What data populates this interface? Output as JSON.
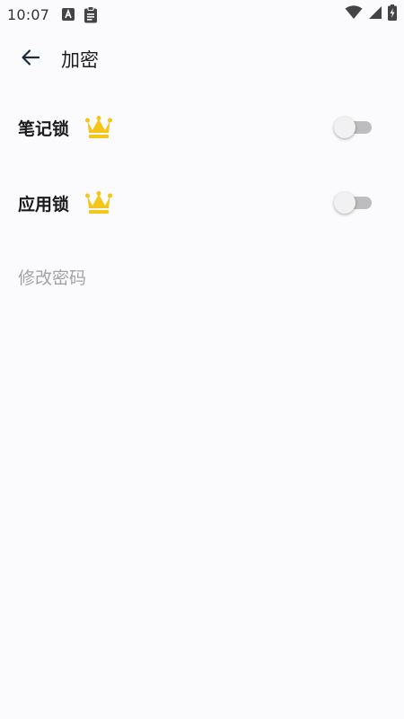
{
  "status_bar": {
    "time": "10:07",
    "icons_left": [
      "a-notification-icon",
      "clipboard-icon"
    ],
    "icons_right": [
      "wifi-icon",
      "cell-signal-icon",
      "battery-charging-icon"
    ]
  },
  "app_bar": {
    "back_icon": "arrow-left-icon",
    "title": "加密"
  },
  "settings": {
    "note_lock": {
      "label": "笔记锁",
      "premium_icon": "crown-icon",
      "enabled": false
    },
    "app_lock": {
      "label": "应用锁",
      "premium_icon": "crown-icon",
      "enabled": false
    },
    "change_password": {
      "label": "修改密码"
    }
  },
  "colors": {
    "background": "#fbfbfd",
    "crown": "#f5c518",
    "switch_track_off": "#bdbdbd",
    "switch_thumb_off": "#f1f1f1",
    "muted_text": "#a3a3a3"
  }
}
